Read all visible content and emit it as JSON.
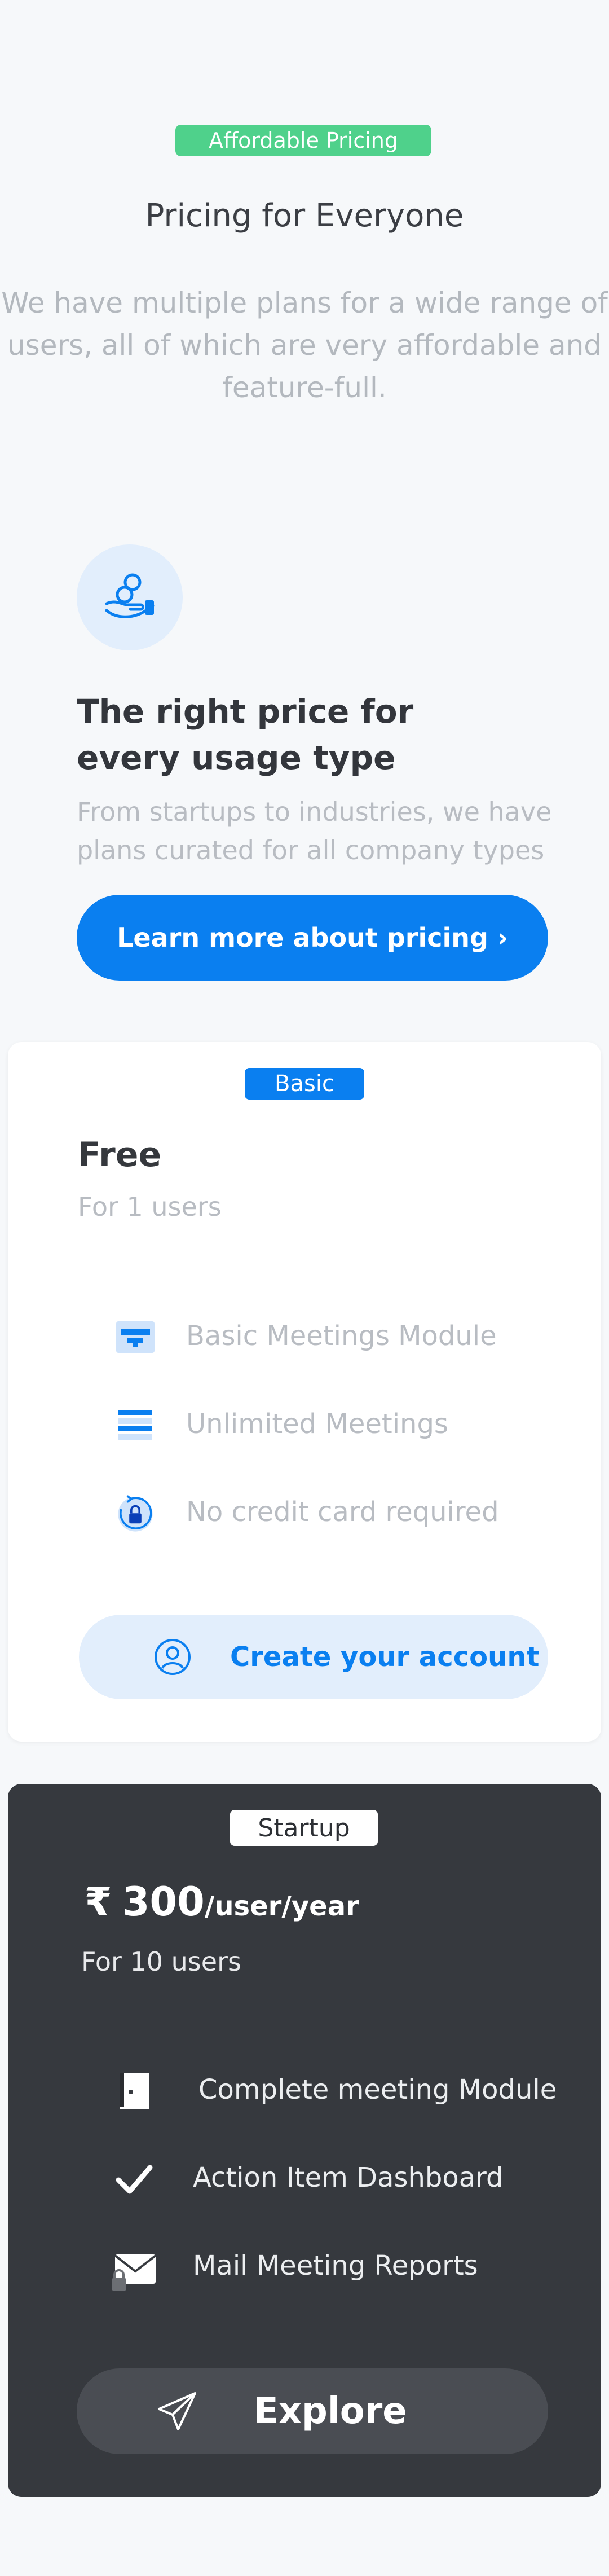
{
  "header": {
    "badge": "Affordable Pricing",
    "title": "Pricing for Everyone",
    "subtitle": "We have multiple plans for a wide range of users, all of which are very affordable and feature-full."
  },
  "intro": {
    "icon": "hand-coins-icon",
    "heading": "The right price for every usage type",
    "description": "From startups to industries, we have plans curated for all company types",
    "cta_label": "Learn more about pricing ›"
  },
  "plans": {
    "basic": {
      "tag": "Basic",
      "name": "Free",
      "users": "For 1 users",
      "features": [
        {
          "icon": "meeting-module-icon",
          "label": "Basic Meetings Module"
        },
        {
          "icon": "list-lines-icon",
          "label": "Unlimited Meetings"
        },
        {
          "icon": "lock-refresh-icon",
          "label": "No credit card required"
        }
      ],
      "cta_icon": "user-circle-icon",
      "cta_label": "Create your account"
    },
    "startup": {
      "tag": "Startup",
      "currency": "₹",
      "price": "300",
      "period": "/user/year",
      "users": "For 10 users",
      "features": [
        {
          "icon": "door-icon",
          "label": "Complete meeting Module"
        },
        {
          "icon": "checkmark-icon",
          "label": "Action Item Dashboard"
        },
        {
          "icon": "mail-lock-icon",
          "label": "Mail Meeting Reports"
        }
      ],
      "cta_icon": "paper-plane-icon",
      "cta_label": "Explore"
    }
  },
  "colors": {
    "background": "#f6f8fa",
    "primary": "#0a7ff0",
    "accent_green": "#4fd18b",
    "dark_card": "#36393e",
    "light_blue": "#e2eefc"
  }
}
